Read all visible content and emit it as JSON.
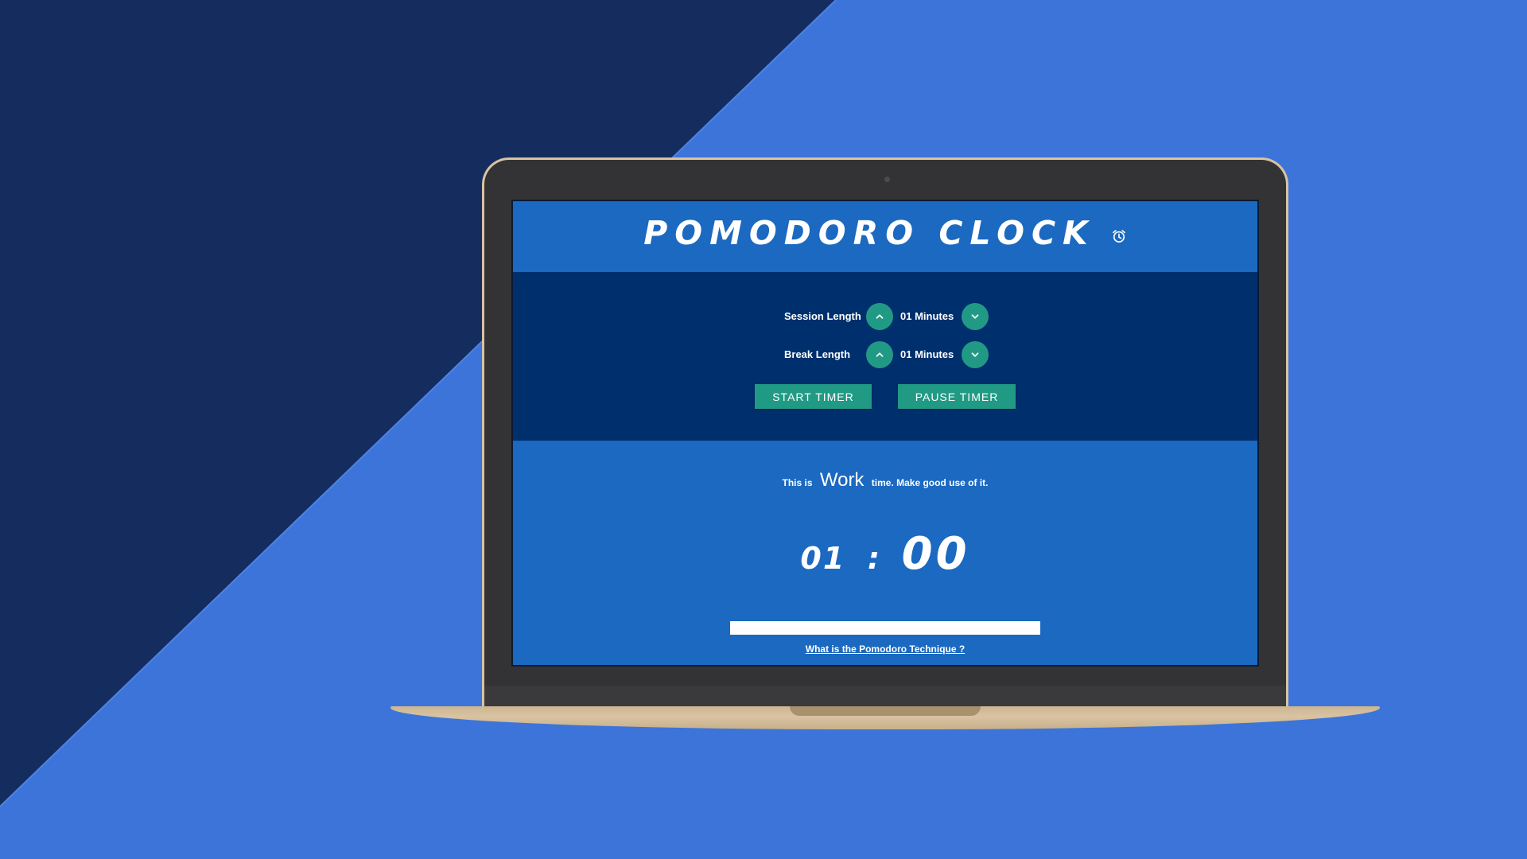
{
  "app": {
    "title": "POMODORO CLOCK",
    "icon": "alarm-clock-icon"
  },
  "controls": {
    "session": {
      "label": "Session Length",
      "value": "01 Minutes"
    },
    "break": {
      "label": "Break Length",
      "value": "01 Minutes"
    },
    "start_label": "START TIMER",
    "pause_label": "PAUSE TIMER"
  },
  "status": {
    "prefix": "This is",
    "mode": "Work",
    "suffix": "time. Make good use of it."
  },
  "timer": {
    "minutes": "01",
    "separator": ":",
    "seconds": "00",
    "progress": 0
  },
  "link": {
    "label": "What is the Pomodoro Technique ?"
  },
  "colors": {
    "accent": "#219a85",
    "header_bg": "#1b69c0",
    "controls_bg": "#002f6d",
    "page_bg_light": "#3d74d9",
    "page_bg_dark": "#152c5e"
  }
}
